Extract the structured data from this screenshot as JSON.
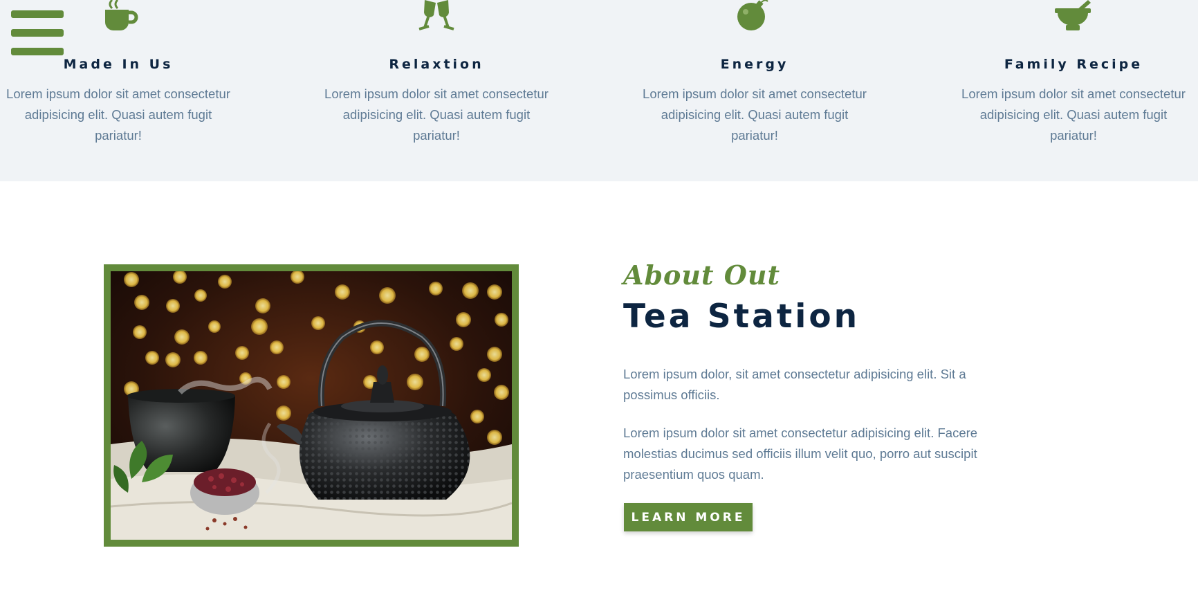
{
  "menu": {
    "icon": "hamburger-menu-icon"
  },
  "features": [
    {
      "icon": "coffee-cup-icon",
      "title": "Made In Us",
      "text": "Lorem ipsum dolor sit amet consectetur adipisicing elit. Quasi autem fugit pariatur!"
    },
    {
      "icon": "toasting-glasses-icon",
      "title": "Relaxtion",
      "text": "Lorem ipsum dolor sit amet consectetur adipisicing elit. Quasi autem fugit pariatur!"
    },
    {
      "icon": "bomb-icon",
      "title": "Energy",
      "text": "Lorem ipsum dolor sit amet consectetur adipisicing elit. Quasi autem fugit pariatur!"
    },
    {
      "icon": "mortar-pestle-icon",
      "title": "Family Recipe",
      "text": "Lorem ipsum dolor sit amet consectetur adipisicing elit. Quasi autem fugit pariatur!"
    }
  ],
  "about": {
    "script_heading": "About Out",
    "title": "Tea Station",
    "paragraph1": "Lorem ipsum dolor, sit amet consectetur adipisicing elit. Sit a possimus officiis.",
    "paragraph2": "Lorem ipsum dolor sit amet consectetur adipisicing elit. Facere molestias ducimus sed officiis illum velit quo, porro aut suscipit praesentium quos quam.",
    "button_label": "LEARN MORE",
    "image": "teapot-and-tea-cup-photo"
  },
  "colors": {
    "accent": "#628b3b",
    "heading": "#0d2541",
    "body_text": "#5e7a94",
    "band_background": "#f0f3f6"
  }
}
